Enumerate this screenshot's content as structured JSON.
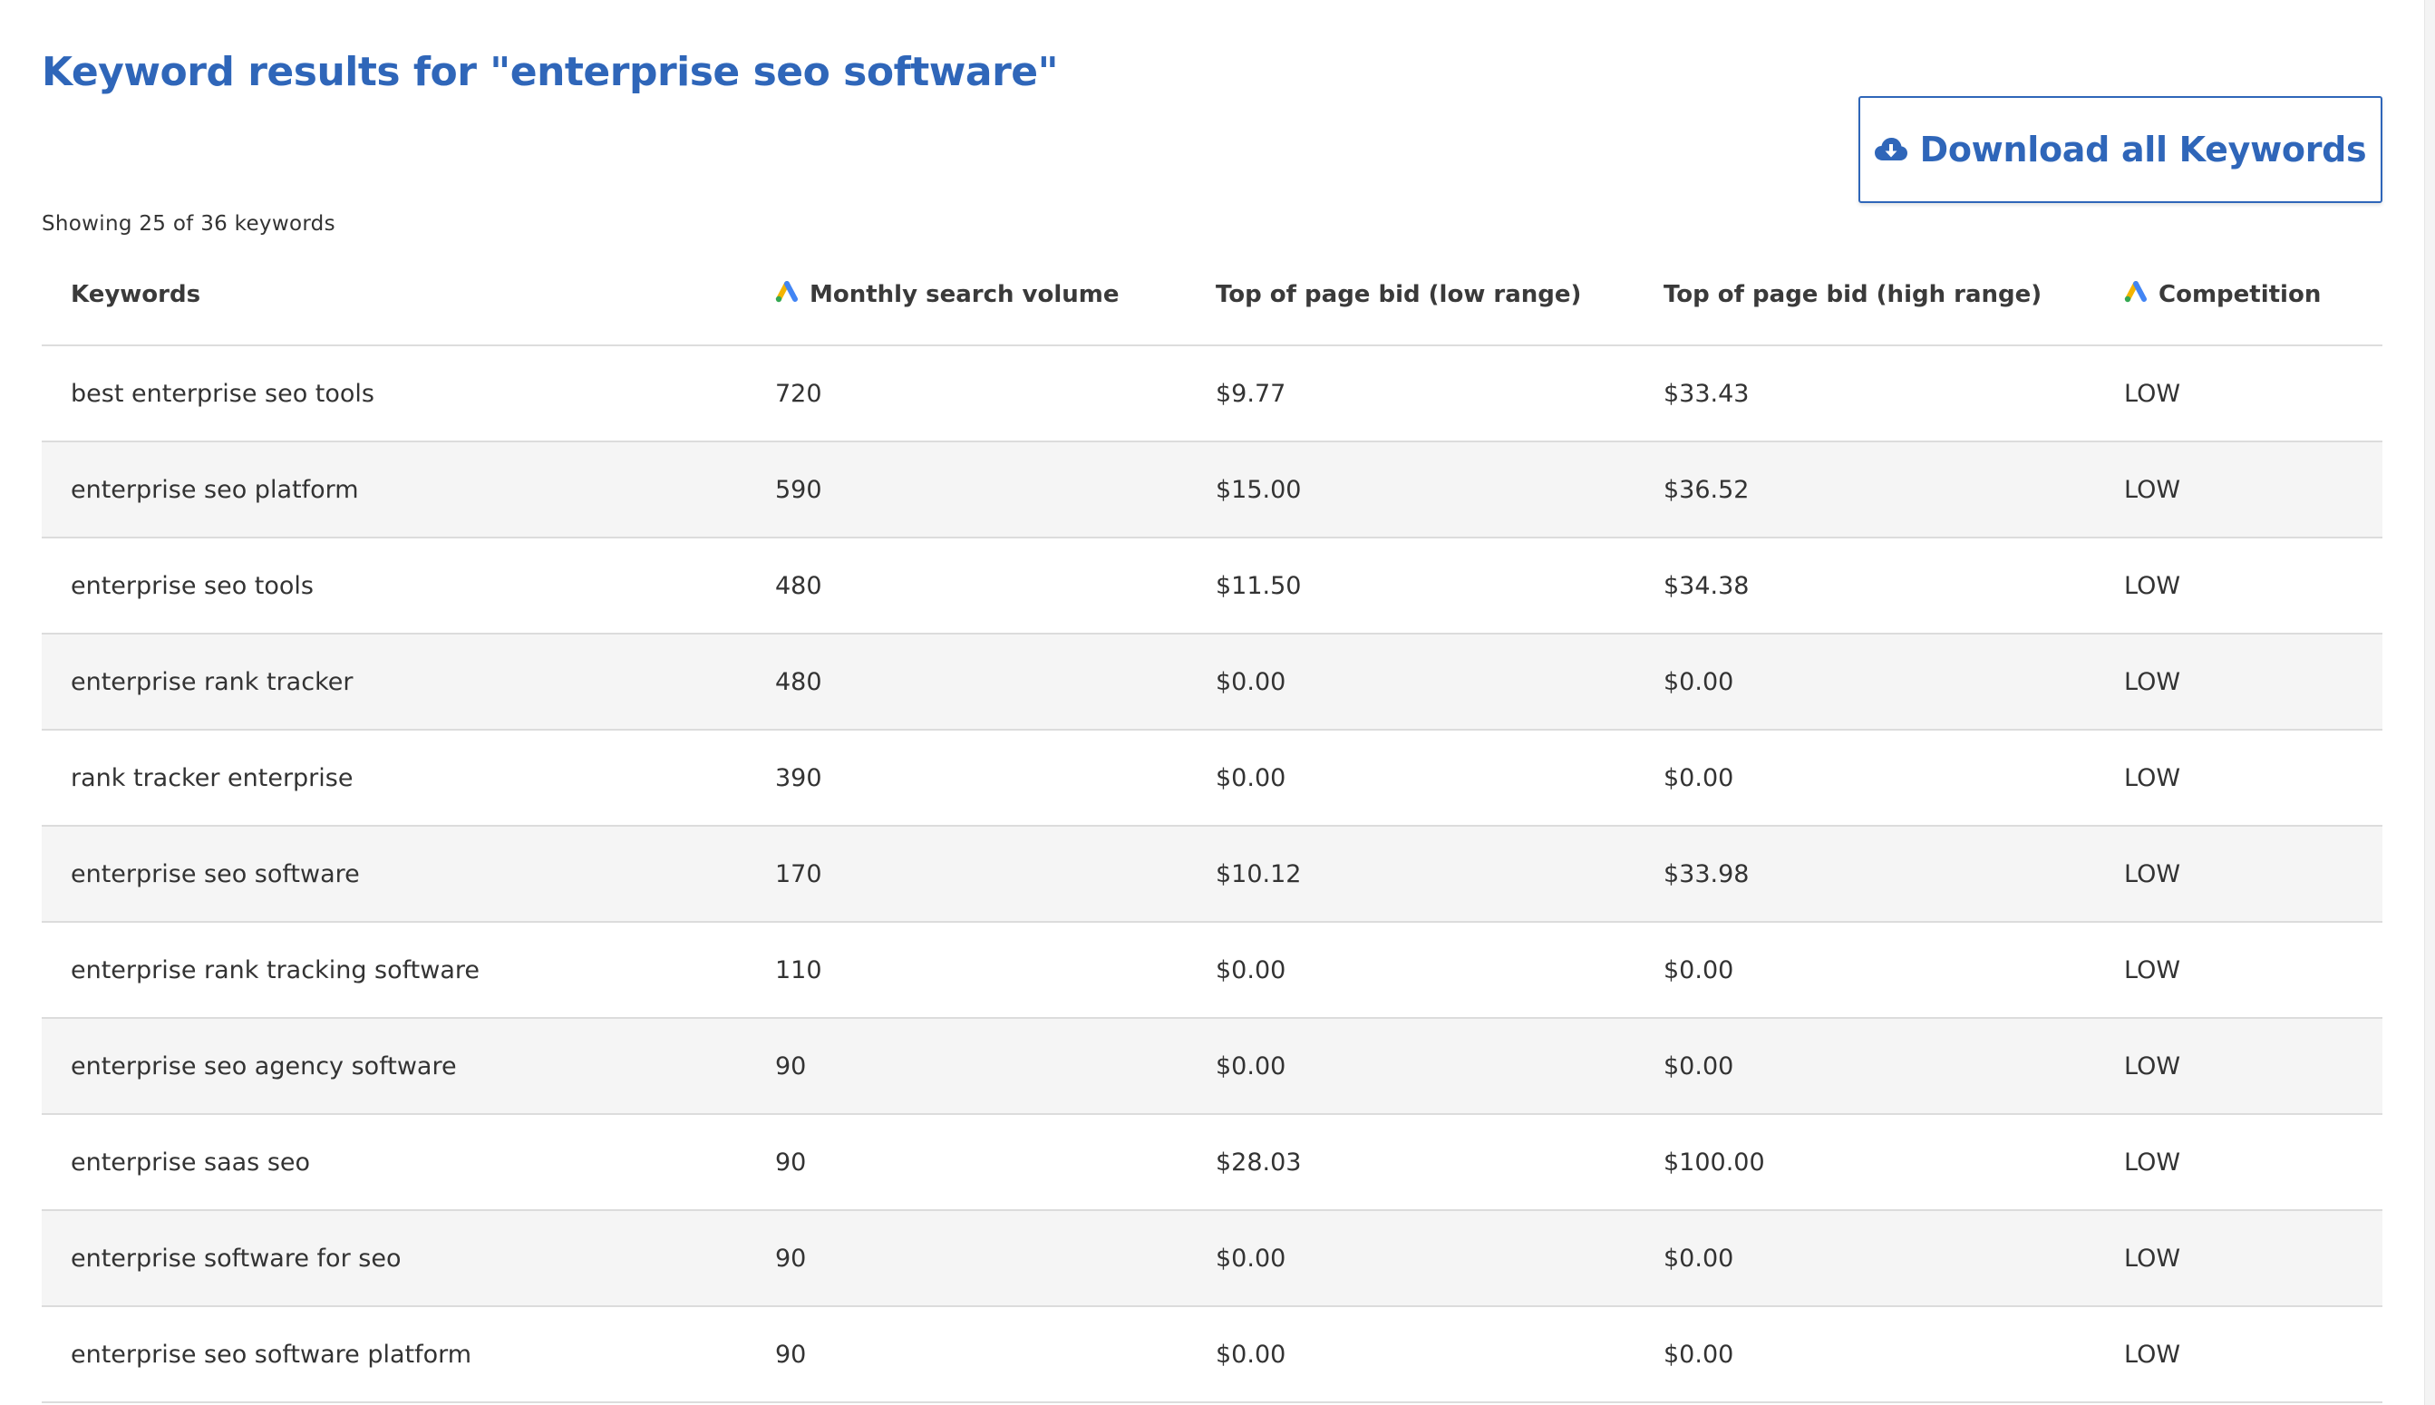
{
  "page": {
    "title": "Keyword results for \"enterprise seo software\"",
    "showing_text": "Showing 25 of 36 keywords"
  },
  "download_button": {
    "label": "Download all Keywords",
    "icon": "cloud-download-icon"
  },
  "colors": {
    "accent": "#2f66b9",
    "row_alt": "#f5f5f5",
    "divider": "#dcdcdc"
  },
  "table": {
    "headers": {
      "keywords": "Keywords",
      "monthly_search_volume": "Monthly search volume",
      "bid_low": "Top of page bid (low range)",
      "bid_high": "Top of page bid (high range)",
      "competition": "Competition"
    },
    "header_icons": {
      "monthly_search_volume": "google-ads-icon",
      "competition": "google-ads-icon"
    },
    "rows": [
      {
        "keyword": "best enterprise seo tools",
        "volume": "720",
        "bid_low": "$9.77",
        "bid_high": "$33.43",
        "competition": "LOW"
      },
      {
        "keyword": "enterprise seo platform",
        "volume": "590",
        "bid_low": "$15.00",
        "bid_high": "$36.52",
        "competition": "LOW"
      },
      {
        "keyword": "enterprise seo tools",
        "volume": "480",
        "bid_low": "$11.50",
        "bid_high": "$34.38",
        "competition": "LOW"
      },
      {
        "keyword": "enterprise rank tracker",
        "volume": "480",
        "bid_low": "$0.00",
        "bid_high": "$0.00",
        "competition": "LOW"
      },
      {
        "keyword": "rank tracker enterprise",
        "volume": "390",
        "bid_low": "$0.00",
        "bid_high": "$0.00",
        "competition": "LOW"
      },
      {
        "keyword": "enterprise seo software",
        "volume": "170",
        "bid_low": "$10.12",
        "bid_high": "$33.98",
        "competition": "LOW"
      },
      {
        "keyword": "enterprise rank tracking software",
        "volume": "110",
        "bid_low": "$0.00",
        "bid_high": "$0.00",
        "competition": "LOW"
      },
      {
        "keyword": "enterprise seo agency software",
        "volume": "90",
        "bid_low": "$0.00",
        "bid_high": "$0.00",
        "competition": "LOW"
      },
      {
        "keyword": "enterprise saas seo",
        "volume": "90",
        "bid_low": "$28.03",
        "bid_high": "$100.00",
        "competition": "LOW"
      },
      {
        "keyword": "enterprise software for seo",
        "volume": "90",
        "bid_low": "$0.00",
        "bid_high": "$0.00",
        "competition": "LOW"
      },
      {
        "keyword": "enterprise seo software platform",
        "volume": "90",
        "bid_low": "$0.00",
        "bid_high": "$0.00",
        "competition": "LOW"
      }
    ]
  }
}
